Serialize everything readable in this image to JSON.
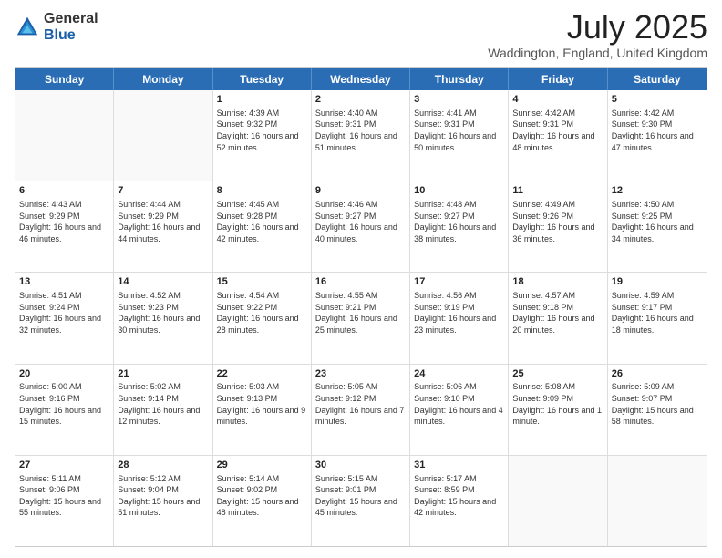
{
  "header": {
    "logo_general": "General",
    "logo_blue": "Blue",
    "month_title": "July 2025",
    "location": "Waddington, England, United Kingdom"
  },
  "calendar": {
    "days": [
      "Sunday",
      "Monday",
      "Tuesday",
      "Wednesday",
      "Thursday",
      "Friday",
      "Saturday"
    ],
    "rows": [
      [
        {
          "day": "",
          "empty": true
        },
        {
          "day": "",
          "empty": true
        },
        {
          "day": "1",
          "sunrise": "Sunrise: 4:39 AM",
          "sunset": "Sunset: 9:32 PM",
          "daylight": "Daylight: 16 hours and 52 minutes."
        },
        {
          "day": "2",
          "sunrise": "Sunrise: 4:40 AM",
          "sunset": "Sunset: 9:31 PM",
          "daylight": "Daylight: 16 hours and 51 minutes."
        },
        {
          "day": "3",
          "sunrise": "Sunrise: 4:41 AM",
          "sunset": "Sunset: 9:31 PM",
          "daylight": "Daylight: 16 hours and 50 minutes."
        },
        {
          "day": "4",
          "sunrise": "Sunrise: 4:42 AM",
          "sunset": "Sunset: 9:31 PM",
          "daylight": "Daylight: 16 hours and 48 minutes."
        },
        {
          "day": "5",
          "sunrise": "Sunrise: 4:42 AM",
          "sunset": "Sunset: 9:30 PM",
          "daylight": "Daylight: 16 hours and 47 minutes."
        }
      ],
      [
        {
          "day": "6",
          "sunrise": "Sunrise: 4:43 AM",
          "sunset": "Sunset: 9:29 PM",
          "daylight": "Daylight: 16 hours and 46 minutes."
        },
        {
          "day": "7",
          "sunrise": "Sunrise: 4:44 AM",
          "sunset": "Sunset: 9:29 PM",
          "daylight": "Daylight: 16 hours and 44 minutes."
        },
        {
          "day": "8",
          "sunrise": "Sunrise: 4:45 AM",
          "sunset": "Sunset: 9:28 PM",
          "daylight": "Daylight: 16 hours and 42 minutes."
        },
        {
          "day": "9",
          "sunrise": "Sunrise: 4:46 AM",
          "sunset": "Sunset: 9:27 PM",
          "daylight": "Daylight: 16 hours and 40 minutes."
        },
        {
          "day": "10",
          "sunrise": "Sunrise: 4:48 AM",
          "sunset": "Sunset: 9:27 PM",
          "daylight": "Daylight: 16 hours and 38 minutes."
        },
        {
          "day": "11",
          "sunrise": "Sunrise: 4:49 AM",
          "sunset": "Sunset: 9:26 PM",
          "daylight": "Daylight: 16 hours and 36 minutes."
        },
        {
          "day": "12",
          "sunrise": "Sunrise: 4:50 AM",
          "sunset": "Sunset: 9:25 PM",
          "daylight": "Daylight: 16 hours and 34 minutes."
        }
      ],
      [
        {
          "day": "13",
          "sunrise": "Sunrise: 4:51 AM",
          "sunset": "Sunset: 9:24 PM",
          "daylight": "Daylight: 16 hours and 32 minutes."
        },
        {
          "day": "14",
          "sunrise": "Sunrise: 4:52 AM",
          "sunset": "Sunset: 9:23 PM",
          "daylight": "Daylight: 16 hours and 30 minutes."
        },
        {
          "day": "15",
          "sunrise": "Sunrise: 4:54 AM",
          "sunset": "Sunset: 9:22 PM",
          "daylight": "Daylight: 16 hours and 28 minutes."
        },
        {
          "day": "16",
          "sunrise": "Sunrise: 4:55 AM",
          "sunset": "Sunset: 9:21 PM",
          "daylight": "Daylight: 16 hours and 25 minutes."
        },
        {
          "day": "17",
          "sunrise": "Sunrise: 4:56 AM",
          "sunset": "Sunset: 9:19 PM",
          "daylight": "Daylight: 16 hours and 23 minutes."
        },
        {
          "day": "18",
          "sunrise": "Sunrise: 4:57 AM",
          "sunset": "Sunset: 9:18 PM",
          "daylight": "Daylight: 16 hours and 20 minutes."
        },
        {
          "day": "19",
          "sunrise": "Sunrise: 4:59 AM",
          "sunset": "Sunset: 9:17 PM",
          "daylight": "Daylight: 16 hours and 18 minutes."
        }
      ],
      [
        {
          "day": "20",
          "sunrise": "Sunrise: 5:00 AM",
          "sunset": "Sunset: 9:16 PM",
          "daylight": "Daylight: 16 hours and 15 minutes."
        },
        {
          "day": "21",
          "sunrise": "Sunrise: 5:02 AM",
          "sunset": "Sunset: 9:14 PM",
          "daylight": "Daylight: 16 hours and 12 minutes."
        },
        {
          "day": "22",
          "sunrise": "Sunrise: 5:03 AM",
          "sunset": "Sunset: 9:13 PM",
          "daylight": "Daylight: 16 hours and 9 minutes."
        },
        {
          "day": "23",
          "sunrise": "Sunrise: 5:05 AM",
          "sunset": "Sunset: 9:12 PM",
          "daylight": "Daylight: 16 hours and 7 minutes."
        },
        {
          "day": "24",
          "sunrise": "Sunrise: 5:06 AM",
          "sunset": "Sunset: 9:10 PM",
          "daylight": "Daylight: 16 hours and 4 minutes."
        },
        {
          "day": "25",
          "sunrise": "Sunrise: 5:08 AM",
          "sunset": "Sunset: 9:09 PM",
          "daylight": "Daylight: 16 hours and 1 minute."
        },
        {
          "day": "26",
          "sunrise": "Sunrise: 5:09 AM",
          "sunset": "Sunset: 9:07 PM",
          "daylight": "Daylight: 15 hours and 58 minutes."
        }
      ],
      [
        {
          "day": "27",
          "sunrise": "Sunrise: 5:11 AM",
          "sunset": "Sunset: 9:06 PM",
          "daylight": "Daylight: 15 hours and 55 minutes."
        },
        {
          "day": "28",
          "sunrise": "Sunrise: 5:12 AM",
          "sunset": "Sunset: 9:04 PM",
          "daylight": "Daylight: 15 hours and 51 minutes."
        },
        {
          "day": "29",
          "sunrise": "Sunrise: 5:14 AM",
          "sunset": "Sunset: 9:02 PM",
          "daylight": "Daylight: 15 hours and 48 minutes."
        },
        {
          "day": "30",
          "sunrise": "Sunrise: 5:15 AM",
          "sunset": "Sunset: 9:01 PM",
          "daylight": "Daylight: 15 hours and 45 minutes."
        },
        {
          "day": "31",
          "sunrise": "Sunrise: 5:17 AM",
          "sunset": "Sunset: 8:59 PM",
          "daylight": "Daylight: 15 hours and 42 minutes."
        },
        {
          "day": "",
          "empty": true
        },
        {
          "day": "",
          "empty": true
        }
      ]
    ]
  }
}
